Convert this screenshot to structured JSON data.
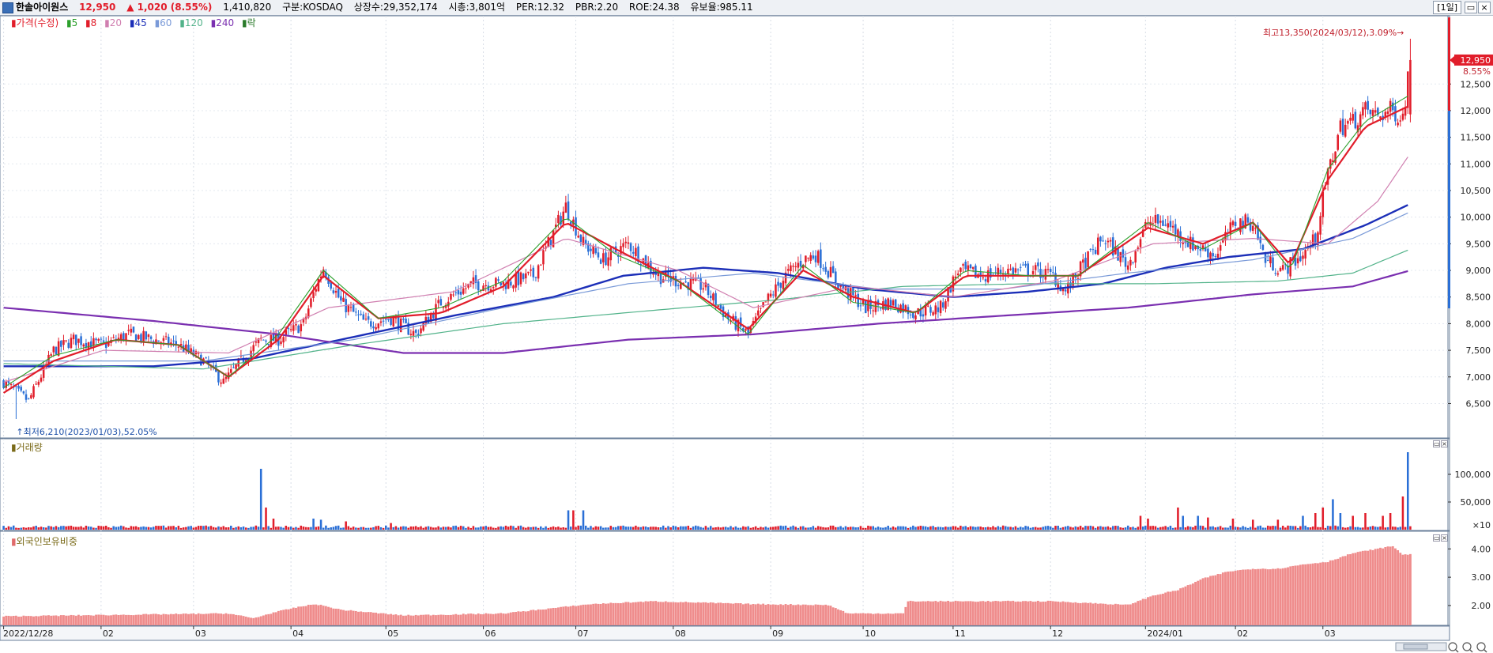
{
  "header": {
    "name": "한솔아이원스",
    "price": "12,950",
    "change": "▲ 1,020 (8.55%)",
    "volume": "1,410,820",
    "market": "구분:KOSDAQ",
    "shares": "상장수:29,352,174",
    "mcap": "시총:3,801억",
    "per": "PER:12.32",
    "pbr": "PBR:2.20",
    "roe": "ROE:24.38",
    "reserve": "유보율:985.11",
    "period": "[1일]"
  },
  "legend": {
    "price_label": "가격(수정)",
    "ma": [
      {
        "label": "5",
        "color": "#2ca02c"
      },
      {
        "label": "8",
        "color": "#e11d2a"
      },
      {
        "label": "20",
        "color": "#d07fb0"
      },
      {
        "label": "45",
        "color": "#1c2fb8"
      },
      {
        "label": "60",
        "color": "#7a9ad8"
      },
      {
        "label": "120",
        "color": "#52b38a"
      },
      {
        "label": "240",
        "color": "#7a2fb0"
      }
    ],
    "extra": "락"
  },
  "annotations": {
    "high": "최고13,350(2024/03/12),3.09%→",
    "low": "최저6,210(2023/01/03),52.05%",
    "current_price": "12,950",
    "current_pct": "8.55%"
  },
  "volume_panel": {
    "title": "거래량",
    "unit": "×10"
  },
  "foreign_panel": {
    "title": "외국인보유비중"
  },
  "colors": {
    "up": "#e11d2a",
    "down": "#2a6fd6",
    "bg": "#ffffff"
  },
  "chart_data": [
    {
      "type": "candlestick",
      "title": "가격(수정)",
      "ylim": [
        6210,
        13350
      ],
      "y_ticks": [
        "6,500",
        "7,000",
        "7,500",
        "8,000",
        "8,500",
        "9,000",
        "9,500",
        "10,000",
        "10,500",
        "11,000",
        "11,500",
        "12,000",
        "12,500"
      ],
      "y_tick_values": [
        6500,
        7000,
        7500,
        8000,
        8500,
        9000,
        9500,
        10000,
        10500,
        11000,
        11500,
        12000,
        12500
      ],
      "x_ticks": [
        "2022/12/28",
        "02",
        "03",
        "04",
        "05",
        "06",
        "07",
        "08",
        "09",
        "10",
        "11",
        "12",
        "2024/01",
        "02",
        "03"
      ],
      "high": {
        "value": 13350,
        "date": "2024/03/12"
      },
      "low": {
        "value": 6210,
        "date": "2023/01/03"
      },
      "last_close": 12950,
      "close_path": [
        [
          0,
          6900
        ],
        [
          10,
          6550
        ],
        [
          20,
          7500
        ],
        [
          28,
          7700
        ],
        [
          40,
          7600
        ],
        [
          50,
          7800
        ],
        [
          60,
          7700
        ],
        [
          70,
          7600
        ],
        [
          80,
          7300
        ],
        [
          88,
          6900
        ],
        [
          95,
          7300
        ],
        [
          103,
          7700
        ],
        [
          110,
          7700
        ],
        [
          120,
          8000
        ],
        [
          125,
          8700
        ],
        [
          128,
          9050
        ],
        [
          135,
          8400
        ],
        [
          145,
          8000
        ],
        [
          155,
          8100
        ],
        [
          165,
          7800
        ],
        [
          175,
          8400
        ],
        [
          188,
          8750
        ],
        [
          200,
          8750
        ],
        [
          212,
          8900
        ],
        [
          220,
          9700
        ],
        [
          225,
          10200
        ],
        [
          232,
          9500
        ],
        [
          240,
          9200
        ],
        [
          250,
          9500
        ],
        [
          262,
          8900
        ],
        [
          270,
          8800
        ],
        [
          280,
          8700
        ],
        [
          290,
          8100
        ],
        [
          298,
          7800
        ],
        [
          305,
          8400
        ],
        [
          313,
          8900
        ],
        [
          320,
          9200
        ],
        [
          325,
          9300
        ],
        [
          335,
          8700
        ],
        [
          345,
          8300
        ],
        [
          355,
          8400
        ],
        [
          365,
          8200
        ],
        [
          375,
          8300
        ],
        [
          382,
          9000
        ],
        [
          392,
          8900
        ],
        [
          402,
          9000
        ],
        [
          412,
          9000
        ],
        [
          420,
          8900
        ],
        [
          425,
          8600
        ],
        [
          432,
          9100
        ],
        [
          440,
          9600
        ],
        [
          450,
          9100
        ],
        [
          458,
          9900
        ],
        [
          465,
          9900
        ],
        [
          475,
          9500
        ],
        [
          485,
          9300
        ],
        [
          493,
          9900
        ],
        [
          500,
          9900
        ],
        [
          505,
          9200
        ],
        [
          512,
          9000
        ],
        [
          520,
          9300
        ],
        [
          525,
          9600
        ],
        [
          530,
          10800
        ],
        [
          535,
          11700
        ],
        [
          540,
          11800
        ],
        [
          545,
          12000
        ],
        [
          550,
          11900
        ],
        [
          555,
          12000
        ],
        [
          560,
          11900
        ],
        [
          563,
          12950
        ]
      ],
      "ma_series": [
        {
          "name": "45",
          "color": "#1c2fb8",
          "width": 2.4,
          "points": [
            [
              0,
              7200
            ],
            [
              60,
              7200
            ],
            [
              100,
              7350
            ],
            [
              140,
              7750
            ],
            [
              180,
              8150
            ],
            [
              220,
              8500
            ],
            [
              248,
              8900
            ],
            [
              280,
              9050
            ],
            [
              310,
              8950
            ],
            [
              345,
              8650
            ],
            [
              380,
              8500
            ],
            [
              410,
              8600
            ],
            [
              440,
              8750
            ],
            [
              465,
              9050
            ],
            [
              490,
              9250
            ],
            [
              520,
              9400
            ],
            [
              545,
              9850
            ],
            [
              563,
              10250
            ]
          ]
        },
        {
          "name": "240",
          "color": "#7a2fb0",
          "width": 2.2,
          "points": [
            [
              0,
              8300
            ],
            [
              60,
              8050
            ],
            [
              110,
              7800
            ],
            [
              160,
              7450
            ],
            [
              200,
              7450
            ],
            [
              250,
              7700
            ],
            [
              300,
              7800
            ],
            [
              350,
              8000
            ],
            [
              400,
              8150
            ],
            [
              450,
              8300
            ],
            [
              500,
              8550
            ],
            [
              540,
              8700
            ],
            [
              563,
              9000
            ]
          ]
        },
        {
          "name": "120",
          "color": "#52b38a",
          "width": 1.2,
          "points": [
            [
              0,
              7250
            ],
            [
              80,
              7150
            ],
            [
              140,
              7600
            ],
            [
              200,
              8000
            ],
            [
              260,
              8250
            ],
            [
              310,
              8450
            ],
            [
              360,
              8700
            ],
            [
              410,
              8750
            ],
            [
              460,
              8750
            ],
            [
              510,
              8800
            ],
            [
              540,
              8950
            ],
            [
              563,
              9400
            ]
          ]
        },
        {
          "name": "60",
          "color": "#7a9ad8",
          "width": 1.2,
          "points": [
            [
              0,
              7300
            ],
            [
              80,
              7300
            ],
            [
              140,
              7700
            ],
            [
              200,
              8300
            ],
            [
              250,
              8750
            ],
            [
              300,
              8950
            ],
            [
              350,
              8650
            ],
            [
              400,
              8650
            ],
            [
              450,
              8950
            ],
            [
              500,
              9200
            ],
            [
              540,
              9600
            ],
            [
              563,
              10100
            ]
          ]
        },
        {
          "name": "20",
          "color": "#d07fb0",
          "width": 1.2,
          "points": [
            [
              0,
              6900
            ],
            [
              40,
              7500
            ],
            [
              90,
              7450
            ],
            [
              130,
              8300
            ],
            [
              180,
              8600
            ],
            [
              225,
              9600
            ],
            [
              270,
              9000
            ],
            [
              300,
              8300
            ],
            [
              340,
              8700
            ],
            [
              380,
              8500
            ],
            [
              420,
              8800
            ],
            [
              460,
              9500
            ],
            [
              500,
              9600
            ],
            [
              530,
              9500
            ],
            [
              550,
              10300
            ],
            [
              563,
              11200
            ]
          ]
        },
        {
          "name": "8",
          "color": "#e11d2a",
          "width": 2.2,
          "points": [
            [
              0,
              6700
            ],
            [
              20,
              7300
            ],
            [
              45,
              7700
            ],
            [
              70,
              7600
            ],
            [
              90,
              7000
            ],
            [
              110,
              7700
            ],
            [
              128,
              8900
            ],
            [
              150,
              8100
            ],
            [
              175,
              8200
            ],
            [
              200,
              8700
            ],
            [
              225,
              9900
            ],
            [
              245,
              9400
            ],
            [
              270,
              8800
            ],
            [
              298,
              7900
            ],
            [
              320,
              9000
            ],
            [
              340,
              8500
            ],
            [
              365,
              8200
            ],
            [
              385,
              8900
            ],
            [
              410,
              8900
            ],
            [
              430,
              8900
            ],
            [
              458,
              9800
            ],
            [
              480,
              9500
            ],
            [
              500,
              9900
            ],
            [
              515,
              9100
            ],
            [
              530,
              10700
            ],
            [
              545,
              11700
            ],
            [
              563,
              12100
            ]
          ]
        },
        {
          "name": "5",
          "color": "#2ca02c",
          "width": 1.1,
          "points": [
            [
              0,
              6800
            ],
            [
              20,
              7400
            ],
            [
              45,
              7700
            ],
            [
              70,
              7600
            ],
            [
              90,
              7000
            ],
            [
              110,
              7800
            ],
            [
              128,
              9000
            ],
            [
              150,
              8100
            ],
            [
              175,
              8300
            ],
            [
              200,
              8800
            ],
            [
              225,
              10000
            ],
            [
              245,
              9300
            ],
            [
              270,
              8800
            ],
            [
              298,
              7800
            ],
            [
              320,
              9100
            ],
            [
              340,
              8400
            ],
            [
              365,
              8200
            ],
            [
              385,
              9000
            ],
            [
              410,
              8900
            ],
            [
              430,
              8900
            ],
            [
              458,
              9900
            ],
            [
              480,
              9400
            ],
            [
              500,
              9900
            ],
            [
              515,
              9000
            ],
            [
              530,
              10900
            ],
            [
              545,
              11800
            ],
            [
              563,
              12300
            ]
          ]
        }
      ]
    },
    {
      "type": "bar",
      "title": "거래량",
      "unit": "×10",
      "y_ticks": [
        "50,000",
        "100,000"
      ],
      "y_tick_values": [
        50000,
        100000
      ],
      "ylim": [
        0,
        145000
      ],
      "baseline": 3000,
      "spikes": [
        [
          103,
          110000
        ],
        [
          105,
          40000
        ],
        [
          108,
          20000
        ],
        [
          124,
          20000
        ],
        [
          127,
          18000
        ],
        [
          137,
          15000
        ],
        [
          155,
          12000
        ],
        [
          226,
          35000
        ],
        [
          228,
          35000
        ],
        [
          232,
          35000
        ],
        [
          455,
          25000
        ],
        [
          458,
          20000
        ],
        [
          470,
          40000
        ],
        [
          472,
          25000
        ],
        [
          478,
          25000
        ],
        [
          482,
          22000
        ],
        [
          492,
          20000
        ],
        [
          500,
          18000
        ],
        [
          510,
          18000
        ],
        [
          520,
          25000
        ],
        [
          525,
          30000
        ],
        [
          528,
          40000
        ],
        [
          532,
          55000
        ],
        [
          535,
          30000
        ],
        [
          540,
          25000
        ],
        [
          545,
          30000
        ],
        [
          552,
          25000
        ],
        [
          555,
          30000
        ],
        [
          560,
          60000
        ],
        [
          562,
          140000
        ]
      ]
    },
    {
      "type": "bar",
      "title": "외국인보유비중",
      "y_ticks": [
        "2.00",
        "3.00",
        "4.00"
      ],
      "y_tick_values": [
        2.0,
        3.0,
        4.0
      ],
      "ylim": [
        1.3,
        4.4
      ],
      "path": [
        [
          0,
          1.62
        ],
        [
          90,
          1.72
        ],
        [
          100,
          1.55
        ],
        [
          108,
          1.75
        ],
        [
          118,
          1.95
        ],
        [
          125,
          2.05
        ],
        [
          135,
          1.85
        ],
        [
          160,
          1.65
        ],
        [
          200,
          1.72
        ],
        [
          235,
          2.05
        ],
        [
          260,
          2.15
        ],
        [
          300,
          2.05
        ],
        [
          330,
          2.02
        ],
        [
          338,
          1.72
        ],
        [
          360,
          1.72
        ],
        [
          362,
          2.15
        ],
        [
          420,
          2.15
        ],
        [
          450,
          2.02
        ],
        [
          460,
          2.35
        ],
        [
          470,
          2.55
        ],
        [
          480,
          2.95
        ],
        [
          490,
          3.2
        ],
        [
          500,
          3.3
        ],
        [
          510,
          3.3
        ],
        [
          520,
          3.45
        ],
        [
          530,
          3.55
        ],
        [
          540,
          3.85
        ],
        [
          556,
          4.1
        ],
        [
          560,
          3.8
        ],
        [
          563,
          3.8
        ]
      ]
    }
  ]
}
